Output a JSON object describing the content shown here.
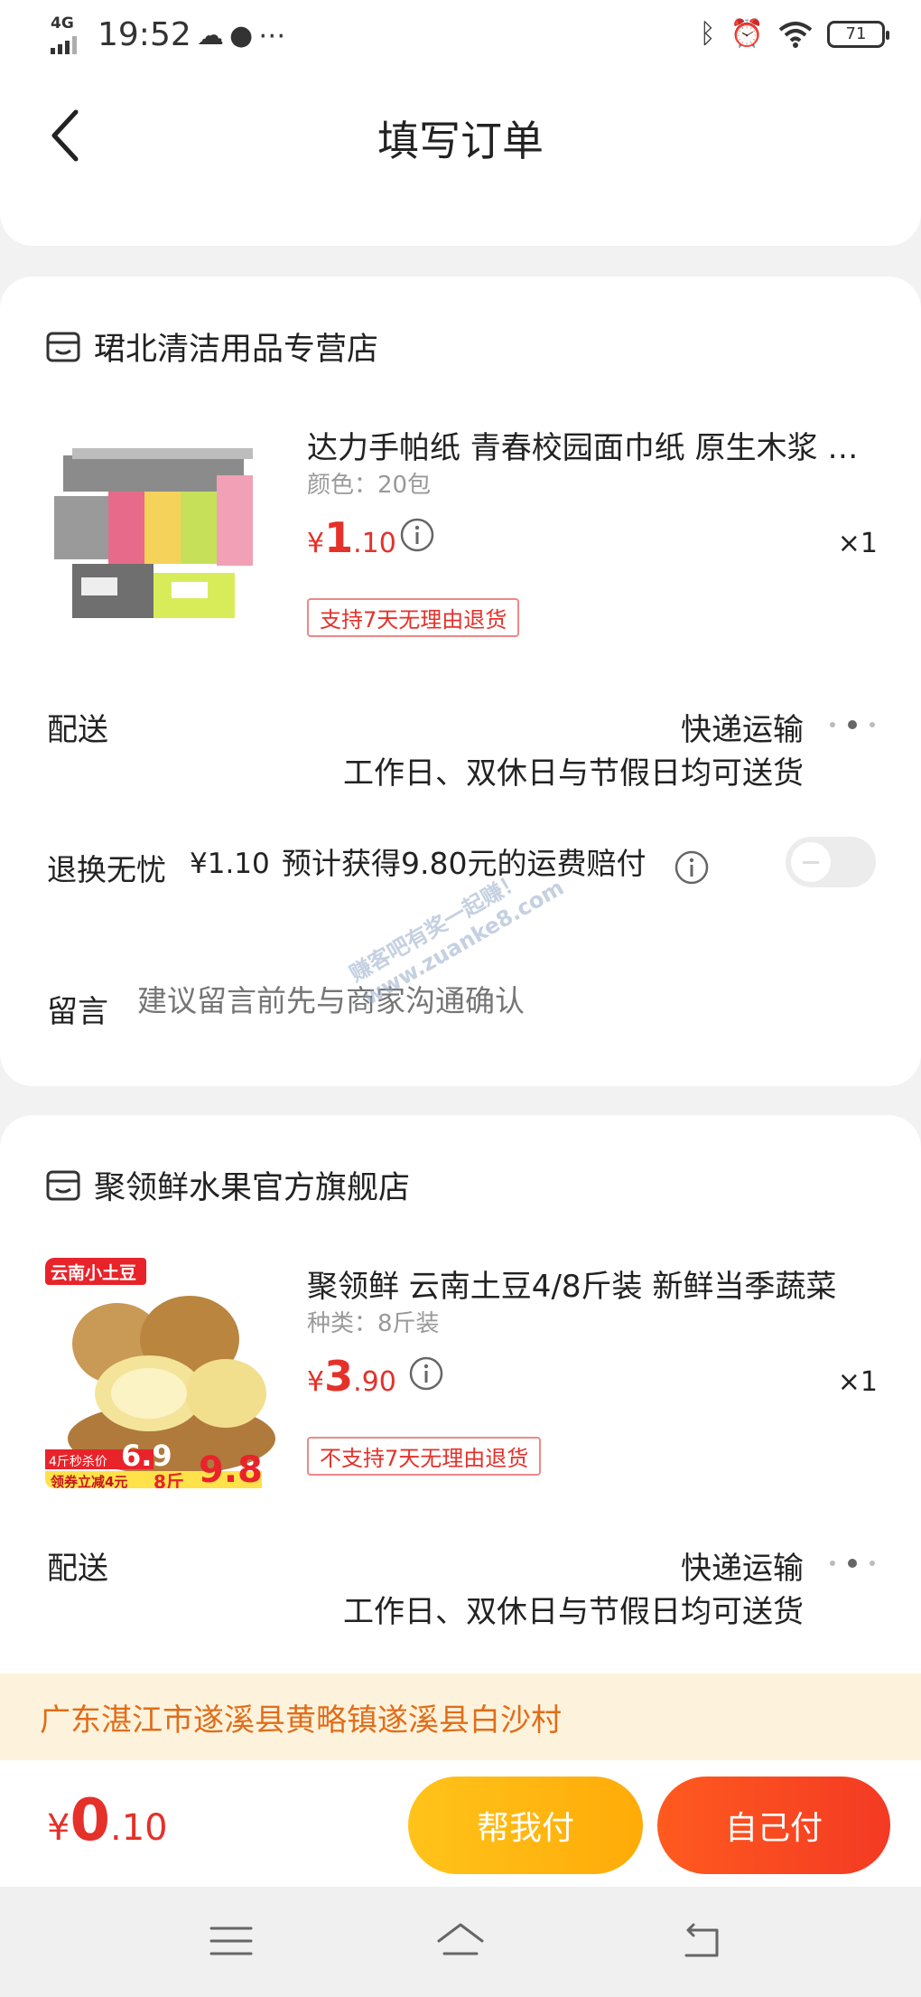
{
  "status_bar": {
    "network": "4G",
    "time": "19:52",
    "battery": "71"
  },
  "header": {
    "title": "填写订单"
  },
  "orders": [
    {
      "shop_name": "珺北清洁用品专营店",
      "product": {
        "title": "达力手帕纸 青春校园面巾纸 原生木浆 便携装",
        "spec": "颜色：20包",
        "price_currency": "¥",
        "price_int": "1",
        "price_dec": ".10",
        "qty": "×1",
        "return_tag": "支持7天无理由退货"
      },
      "delivery": {
        "label": "配送",
        "method": "快递运输",
        "note": "工作日、双休日与节假日均可送货"
      },
      "insurance": {
        "label": "退换无忧",
        "price": "¥1.10",
        "text": "预计获得9.80元的运费赔付"
      },
      "message": {
        "label": "留言",
        "placeholder": "建议留言前先与商家沟通确认"
      }
    },
    {
      "shop_name": "聚领鲜水果官方旗舰店",
      "product": {
        "title": "聚领鲜 云南土豆4/8斤装 新鲜当季蔬菜",
        "spec": "种类：8斤装",
        "price_currency": "¥",
        "price_int": "3",
        "price_dec": ".90",
        "qty": "×1",
        "return_tag": "不支持7天无理由退货",
        "image_text": {
          "badge": "云南小土豆",
          "promo1_label": "4斤秒杀价",
          "promo1_price": "6.9",
          "promo2_label": "领券立减4元",
          "promo2_weight": "8斤",
          "promo2_price": "9.8"
        }
      },
      "delivery": {
        "label": "配送",
        "method": "快递运输",
        "note": "工作日、双休日与节假日均可送货"
      }
    }
  ],
  "watermark": {
    "line1": "赚客吧有奖一起赚！",
    "line2": "www.zuanke8.com"
  },
  "address": "广东湛江市遂溪县黄略镇遂溪县白沙村",
  "bottom": {
    "total_currency": "¥",
    "total_int": "0",
    "total_dec": ".10",
    "help_pay": "帮我付",
    "self_pay": "自己付"
  },
  "colors": {
    "price_red": "#e4312a",
    "help_btn": "#ffb40f",
    "self_btn": "#f5452a",
    "address_bg": "#fdf3dc"
  }
}
